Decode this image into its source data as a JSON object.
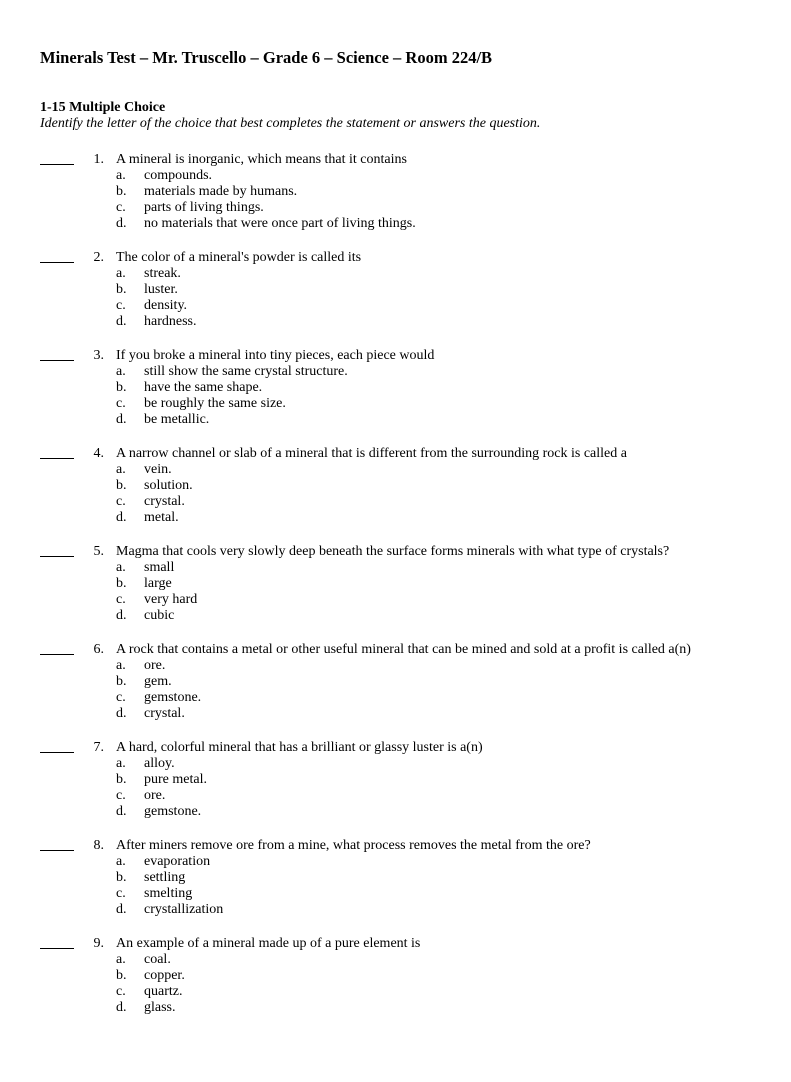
{
  "title": "Minerals Test – Mr. Truscello – Grade 6 – Science – Room 224/B",
  "section_header": "1-15 Multiple Choice",
  "instructions": "Identify the letter of the choice that best completes the statement or answers the question.",
  "questions": [
    {
      "num": "1",
      "text": "A mineral is inorganic, which means that it contains",
      "choices": [
        {
          "letter": "a",
          "text": "compounds."
        },
        {
          "letter": "b",
          "text": "materials made by humans."
        },
        {
          "letter": "c",
          "text": "parts of living things."
        },
        {
          "letter": "d",
          "text": "no materials that were once part of living things."
        }
      ]
    },
    {
      "num": "2",
      "text": "The color of a mineral's powder is called its",
      "choices": [
        {
          "letter": "a",
          "text": "streak."
        },
        {
          "letter": "b",
          "text": "luster."
        },
        {
          "letter": "c",
          "text": "density."
        },
        {
          "letter": "d",
          "text": "hardness."
        }
      ]
    },
    {
      "num": "3",
      "text": "If you broke a mineral into tiny pieces, each piece would",
      "choices": [
        {
          "letter": "a",
          "text": "still show the same crystal structure."
        },
        {
          "letter": "b",
          "text": "have the same shape."
        },
        {
          "letter": "c",
          "text": "be roughly the same size."
        },
        {
          "letter": "d",
          "text": "be metallic."
        }
      ]
    },
    {
      "num": "4",
      "text": "A narrow channel or slab of a mineral that is different from the surrounding rock is called a",
      "choices": [
        {
          "letter": "a",
          "text": "vein."
        },
        {
          "letter": "b",
          "text": "solution."
        },
        {
          "letter": "c",
          "text": "crystal."
        },
        {
          "letter": "d",
          "text": "metal."
        }
      ]
    },
    {
      "num": "5",
      "text": "Magma that cools very slowly deep beneath the surface forms minerals with what type of crystals?",
      "choices": [
        {
          "letter": "a",
          "text": "small"
        },
        {
          "letter": "b",
          "text": "large"
        },
        {
          "letter": "c",
          "text": "very hard"
        },
        {
          "letter": "d",
          "text": "cubic"
        }
      ]
    },
    {
      "num": "6",
      "text": "A rock that contains a metal or other useful mineral that can be mined and sold at a profit is called a(n)",
      "choices": [
        {
          "letter": "a",
          "text": "ore."
        },
        {
          "letter": "b",
          "text": "gem."
        },
        {
          "letter": "c",
          "text": "gemstone."
        },
        {
          "letter": "d",
          "text": "crystal."
        }
      ]
    },
    {
      "num": "7",
      "text": "A hard, colorful mineral that has a brilliant or glassy luster is a(n)",
      "choices": [
        {
          "letter": "a",
          "text": "alloy."
        },
        {
          "letter": "b",
          "text": "pure metal."
        },
        {
          "letter": "c",
          "text": "ore."
        },
        {
          "letter": "d",
          "text": "gemstone."
        }
      ]
    },
    {
      "num": "8",
      "text": "After miners remove ore from a mine, what process removes the metal from the ore?",
      "choices": [
        {
          "letter": "a",
          "text": "evaporation"
        },
        {
          "letter": "b",
          "text": "settling"
        },
        {
          "letter": "c",
          "text": "smelting"
        },
        {
          "letter": "d",
          "text": "crystallization"
        }
      ]
    },
    {
      "num": "9",
      "text": "An example of a mineral made up of a pure element is",
      "choices": [
        {
          "letter": "a",
          "text": "coal."
        },
        {
          "letter": "b",
          "text": "copper."
        },
        {
          "letter": "c",
          "text": "quartz."
        },
        {
          "letter": "d",
          "text": "glass."
        }
      ]
    }
  ]
}
